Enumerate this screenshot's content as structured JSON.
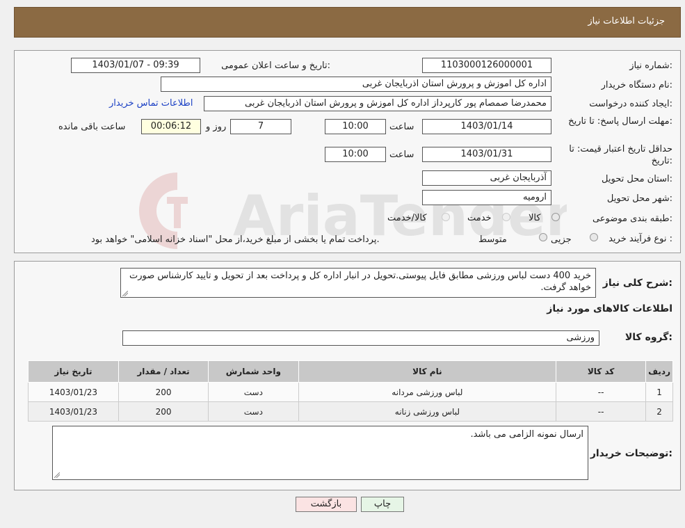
{
  "header": {
    "title": "جزئیات اطلاعات نیاز"
  },
  "form": {
    "need_number_label": "شماره نیاز:",
    "need_number": "1103000126000001",
    "announce_label": "تاریخ و ساعت اعلان عمومی:",
    "announce_value": "1403/01/07 - 09:39",
    "buyer_org_label": "نام دستگاه خریدار:",
    "buyer_org": "اداره کل اموزش و پرورش استان اذربایجان غربی",
    "creator_label": "ایجاد کننده درخواست:",
    "creator": "محمدرضا صمصام پور کارپرداز اداره کل اموزش و پرورش استان اذربایجان غربی",
    "contact_link": "اطلاعات تماس خریدار",
    "deadline_label": "مهلت ارسال پاسخ: تا تاریخ:",
    "deadline_date": "1403/01/14",
    "time_label": "ساعت",
    "deadline_time": "10:00",
    "days": "7",
    "days_label": "روز و",
    "remaining": "00:06:12",
    "remaining_label": "ساعت باقی مانده",
    "validity_label": "حداقل تاریخ اعتبار قیمت: تا تاریخ:",
    "validity_date": "1403/01/31",
    "validity_time": "10:00",
    "province_label": "استان محل تحویل:",
    "province": "آذربایجان غربی",
    "city_label": "شهر محل تحویل:",
    "city": "ارومیه",
    "category_label": "طبقه بندی موضوعی:",
    "category_options": [
      "کالا",
      "خدمت",
      "کالا/خدمت"
    ],
    "process_label": "نوع فرآیند خرید :",
    "process_options": [
      "جزیی",
      "متوسط"
    ],
    "process_note": "پرداخت تمام یا بخشی از مبلغ خرید،از محل \"اسناد خزانه اسلامی\" خواهد بود."
  },
  "description": {
    "label": "شرح کلی نیاز:",
    "text": "خرید 400 دست لباس ورزشی مطابق فایل پیوستی.تحویل در انبار اداره کل و پرداخت بعد از تحویل و تایید کارشناس صورت خواهد گرفت."
  },
  "items_section": {
    "title": "اطلاعات کالاهای مورد نیاز",
    "group_label": "گروه کالا:",
    "group_value": "ورزشی",
    "columns": [
      "ردیف",
      "کد کالا",
      "نام کالا",
      "واحد شمارش",
      "تعداد / مقدار",
      "تاریخ نیاز"
    ],
    "rows": [
      [
        "1",
        "--",
        "لباس ورزشی مردانه",
        "دست",
        "200",
        "1403/01/23"
      ],
      [
        "2",
        "--",
        "لباس ورزشی زنانه",
        "دست",
        "200",
        "1403/01/23"
      ]
    ]
  },
  "buyer_notes": {
    "label": "توضیحات خریدار:",
    "text": "ارسال نمونه الزامی می باشد."
  },
  "buttons": {
    "print": "چاپ",
    "back": "بازگشت"
  },
  "watermark": "AriaTender.neT"
}
